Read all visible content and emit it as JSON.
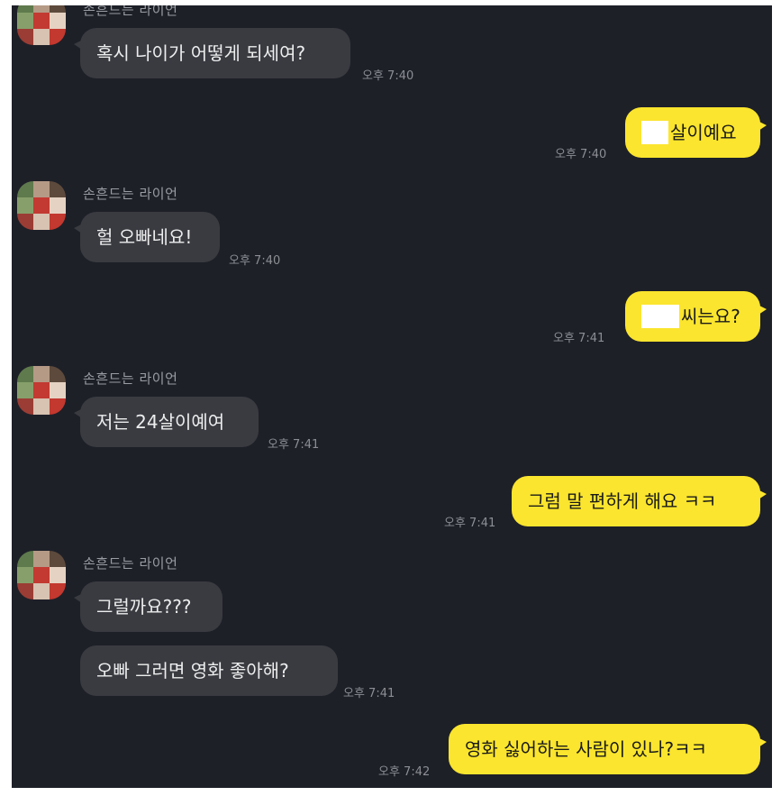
{
  "sender_name": "손흔드는 라이언",
  "messages": {
    "m1": {
      "text": "혹시 나이가 어떻게 되세여?",
      "time": "오후 7:40"
    },
    "m2": {
      "text": "살이예요",
      "time": "오후 7:40"
    },
    "m3": {
      "text": "헐 오빠네요!",
      "time": "오후 7:40"
    },
    "m4": {
      "text": "씨는요?",
      "time": "오후 7:41"
    },
    "m5": {
      "text": "저는 24살이예여",
      "time": "오후 7:41"
    },
    "m6": {
      "text": "그럼 말 편하게 해요 ㅋㅋ",
      "time": "오후 7:41"
    },
    "m7": {
      "text": "그럴까요???"
    },
    "m8": {
      "text": "오빠 그러면 영화 좋아해?",
      "time": "오후 7:41"
    },
    "m9": {
      "text": "영화 싫어하는 사람이 있나?ㅋㅋ",
      "time": "오후 7:42"
    }
  },
  "colors": {
    "background": "#1e2028",
    "incoming_bubble": "#3a3b41",
    "outgoing_bubble": "#fbe52e"
  }
}
